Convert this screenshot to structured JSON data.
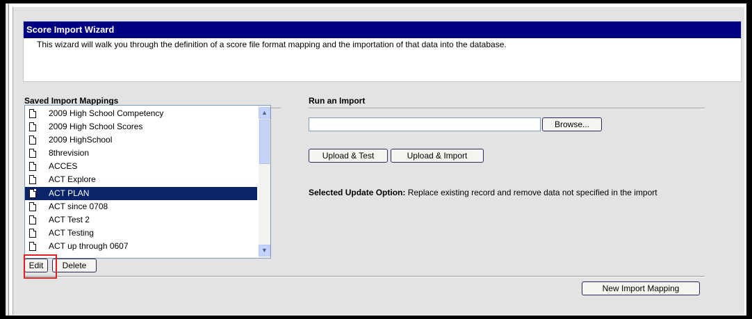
{
  "wizard": {
    "title": "Score Import Wizard",
    "description": "This wizard will walk you through the definition of a score file format mapping and the importation of that data into the database."
  },
  "mappings": {
    "title": "Saved Import Mappings",
    "items": [
      "2009 High School Competency",
      "2009 High School Scores",
      "2009 HighSchool",
      "8threvision",
      "ACCES",
      "ACT Explore",
      "ACT PLAN",
      "ACT since 0708",
      "ACT Test 2",
      "ACT Testing",
      "ACT up through 0607"
    ],
    "selected": "ACT PLAN",
    "edit_label": "Edit",
    "delete_label": "Delete"
  },
  "import": {
    "title": "Run an Import",
    "file_value": "",
    "browse_label": "Browse...",
    "upload_test_label": "Upload & Test",
    "upload_import_label": "Upload & Import",
    "update_option_label": "Selected Update Option:",
    "update_option_value": "Replace existing record and remove data not specified in the import"
  },
  "footer": {
    "new_mapping_label": "New Import Mapping"
  },
  "colors": {
    "header_bg": "#000080",
    "selected_bg": "#0a246a",
    "highlight": "#e02020"
  }
}
